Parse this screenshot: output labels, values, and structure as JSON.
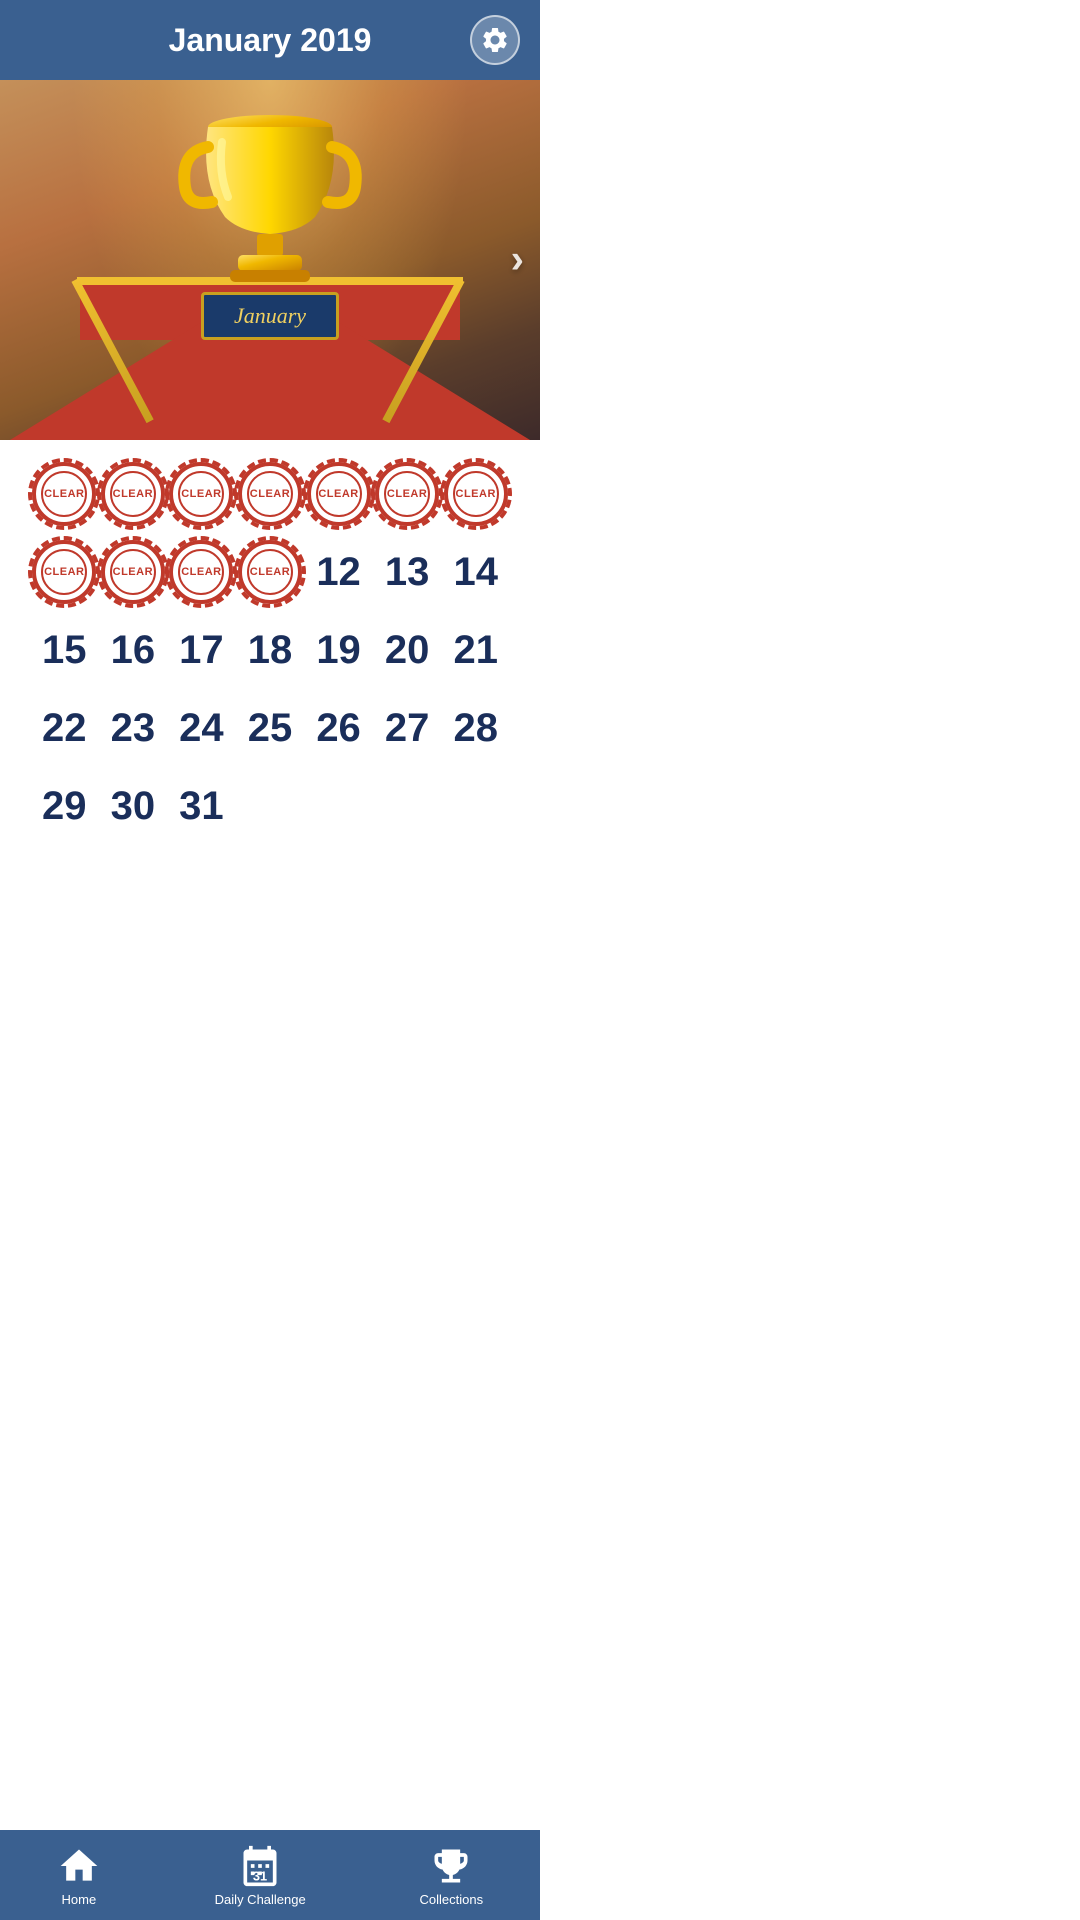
{
  "header": {
    "title": "January 2019"
  },
  "nav": {
    "home_label": "Home",
    "daily_label": "Daily Challenge",
    "collections_label": "Collections"
  },
  "plaque": {
    "text": "January"
  },
  "calendar": {
    "cleared_days": [
      1,
      2,
      3,
      4,
      5,
      6,
      7,
      8,
      9,
      10,
      11
    ],
    "rows": [
      [
        "CLEAR",
        "CLEAR",
        "CLEAR",
        "CLEAR",
        "CLEAR",
        "CLEAR",
        "CLEAR"
      ],
      [
        "CLEAR",
        "CLEAR",
        "CLEAR",
        "CLEAR",
        12,
        13,
        14
      ],
      [
        15,
        16,
        17,
        18,
        19,
        20,
        21
      ],
      [
        22,
        23,
        24,
        25,
        26,
        27,
        28
      ],
      [
        29,
        30,
        31,
        "",
        "",
        "",
        ""
      ]
    ]
  }
}
